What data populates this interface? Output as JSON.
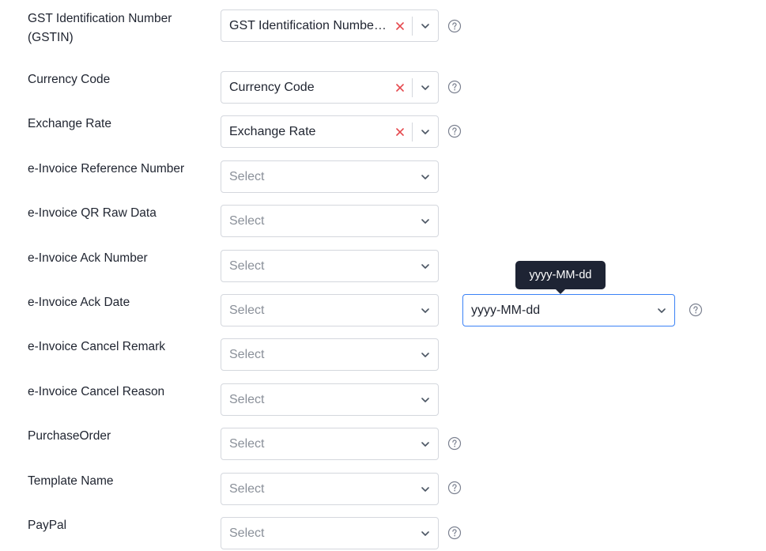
{
  "fields": [
    {
      "label": "GST Identification Number (GSTIN)",
      "value": "GST Identification Number (GSTIN)",
      "placeholder": false,
      "clearable": true,
      "help": true
    },
    {
      "label": "Currency Code",
      "value": "Currency Code",
      "placeholder": false,
      "clearable": true,
      "help": true
    },
    {
      "label": "Exchange Rate",
      "value": "Exchange Rate",
      "placeholder": false,
      "clearable": true,
      "help": true
    },
    {
      "label": "e-Invoice Reference Number",
      "value": "Select",
      "placeholder": true,
      "clearable": false,
      "help": false
    },
    {
      "label": "e-Invoice QR Raw Data",
      "value": "Select",
      "placeholder": true,
      "clearable": false,
      "help": false
    },
    {
      "label": "e-Invoice Ack Number",
      "value": "Select",
      "placeholder": true,
      "clearable": false,
      "help": false
    },
    {
      "label": "e-Invoice Ack Date",
      "value": "Select",
      "placeholder": true,
      "clearable": false,
      "help": false
    },
    {
      "label": "e-Invoice Cancel Remark",
      "value": "Select",
      "placeholder": true,
      "clearable": false,
      "help": false
    },
    {
      "label": "e-Invoice Cancel Reason",
      "value": "Select",
      "placeholder": true,
      "clearable": false,
      "help": false
    },
    {
      "label": "PurchaseOrder",
      "value": "Select",
      "placeholder": true,
      "clearable": false,
      "help": true
    },
    {
      "label": "Template Name",
      "value": "Select",
      "placeholder": true,
      "clearable": false,
      "help": true
    },
    {
      "label": "PayPal",
      "value": "Select",
      "placeholder": true,
      "clearable": false,
      "help": true
    }
  ],
  "date_format": {
    "value": "yyyy-MM-dd",
    "tooltip": "yyyy-MM-dd"
  },
  "colors": {
    "clear_icon": "#e5484d",
    "focus_border": "#3b82f6",
    "tooltip_bg": "#1e2434"
  },
  "icons": {
    "clear": "close-icon",
    "dropdown": "chevron-down-icon",
    "help": "question-circle-icon"
  }
}
